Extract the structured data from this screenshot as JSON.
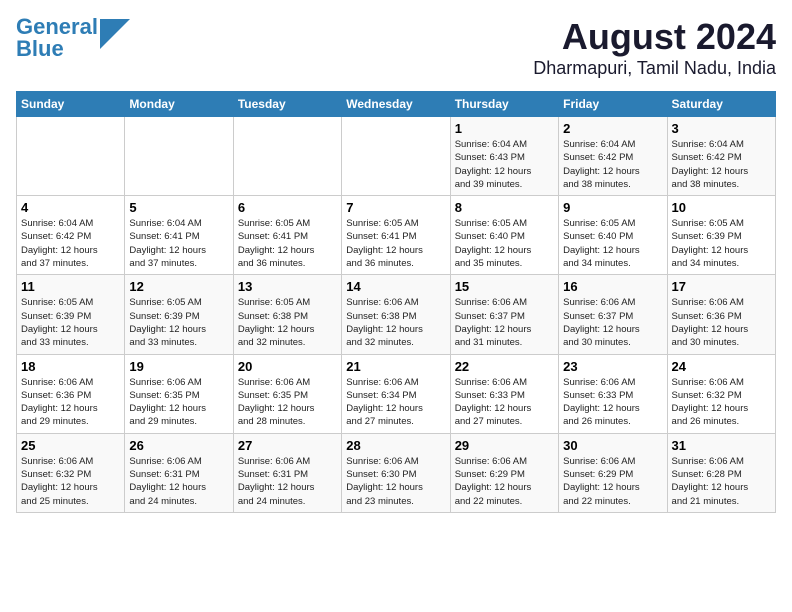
{
  "logo": {
    "line1": "General",
    "line2": "Blue"
  },
  "title": "August 2024",
  "subtitle": "Dharmapuri, Tamil Nadu, India",
  "days_of_week": [
    "Sunday",
    "Monday",
    "Tuesday",
    "Wednesday",
    "Thursday",
    "Friday",
    "Saturday"
  ],
  "weeks": [
    [
      {
        "day": "",
        "info": ""
      },
      {
        "day": "",
        "info": ""
      },
      {
        "day": "",
        "info": ""
      },
      {
        "day": "",
        "info": ""
      },
      {
        "day": "1",
        "info": "Sunrise: 6:04 AM\nSunset: 6:43 PM\nDaylight: 12 hours\nand 39 minutes."
      },
      {
        "day": "2",
        "info": "Sunrise: 6:04 AM\nSunset: 6:42 PM\nDaylight: 12 hours\nand 38 minutes."
      },
      {
        "day": "3",
        "info": "Sunrise: 6:04 AM\nSunset: 6:42 PM\nDaylight: 12 hours\nand 38 minutes."
      }
    ],
    [
      {
        "day": "4",
        "info": "Sunrise: 6:04 AM\nSunset: 6:42 PM\nDaylight: 12 hours\nand 37 minutes."
      },
      {
        "day": "5",
        "info": "Sunrise: 6:04 AM\nSunset: 6:41 PM\nDaylight: 12 hours\nand 37 minutes."
      },
      {
        "day": "6",
        "info": "Sunrise: 6:05 AM\nSunset: 6:41 PM\nDaylight: 12 hours\nand 36 minutes."
      },
      {
        "day": "7",
        "info": "Sunrise: 6:05 AM\nSunset: 6:41 PM\nDaylight: 12 hours\nand 36 minutes."
      },
      {
        "day": "8",
        "info": "Sunrise: 6:05 AM\nSunset: 6:40 PM\nDaylight: 12 hours\nand 35 minutes."
      },
      {
        "day": "9",
        "info": "Sunrise: 6:05 AM\nSunset: 6:40 PM\nDaylight: 12 hours\nand 34 minutes."
      },
      {
        "day": "10",
        "info": "Sunrise: 6:05 AM\nSunset: 6:39 PM\nDaylight: 12 hours\nand 34 minutes."
      }
    ],
    [
      {
        "day": "11",
        "info": "Sunrise: 6:05 AM\nSunset: 6:39 PM\nDaylight: 12 hours\nand 33 minutes."
      },
      {
        "day": "12",
        "info": "Sunrise: 6:05 AM\nSunset: 6:39 PM\nDaylight: 12 hours\nand 33 minutes."
      },
      {
        "day": "13",
        "info": "Sunrise: 6:05 AM\nSunset: 6:38 PM\nDaylight: 12 hours\nand 32 minutes."
      },
      {
        "day": "14",
        "info": "Sunrise: 6:06 AM\nSunset: 6:38 PM\nDaylight: 12 hours\nand 32 minutes."
      },
      {
        "day": "15",
        "info": "Sunrise: 6:06 AM\nSunset: 6:37 PM\nDaylight: 12 hours\nand 31 minutes."
      },
      {
        "day": "16",
        "info": "Sunrise: 6:06 AM\nSunset: 6:37 PM\nDaylight: 12 hours\nand 30 minutes."
      },
      {
        "day": "17",
        "info": "Sunrise: 6:06 AM\nSunset: 6:36 PM\nDaylight: 12 hours\nand 30 minutes."
      }
    ],
    [
      {
        "day": "18",
        "info": "Sunrise: 6:06 AM\nSunset: 6:36 PM\nDaylight: 12 hours\nand 29 minutes."
      },
      {
        "day": "19",
        "info": "Sunrise: 6:06 AM\nSunset: 6:35 PM\nDaylight: 12 hours\nand 29 minutes."
      },
      {
        "day": "20",
        "info": "Sunrise: 6:06 AM\nSunset: 6:35 PM\nDaylight: 12 hours\nand 28 minutes."
      },
      {
        "day": "21",
        "info": "Sunrise: 6:06 AM\nSunset: 6:34 PM\nDaylight: 12 hours\nand 27 minutes."
      },
      {
        "day": "22",
        "info": "Sunrise: 6:06 AM\nSunset: 6:33 PM\nDaylight: 12 hours\nand 27 minutes."
      },
      {
        "day": "23",
        "info": "Sunrise: 6:06 AM\nSunset: 6:33 PM\nDaylight: 12 hours\nand 26 minutes."
      },
      {
        "day": "24",
        "info": "Sunrise: 6:06 AM\nSunset: 6:32 PM\nDaylight: 12 hours\nand 26 minutes."
      }
    ],
    [
      {
        "day": "25",
        "info": "Sunrise: 6:06 AM\nSunset: 6:32 PM\nDaylight: 12 hours\nand 25 minutes."
      },
      {
        "day": "26",
        "info": "Sunrise: 6:06 AM\nSunset: 6:31 PM\nDaylight: 12 hours\nand 24 minutes."
      },
      {
        "day": "27",
        "info": "Sunrise: 6:06 AM\nSunset: 6:31 PM\nDaylight: 12 hours\nand 24 minutes."
      },
      {
        "day": "28",
        "info": "Sunrise: 6:06 AM\nSunset: 6:30 PM\nDaylight: 12 hours\nand 23 minutes."
      },
      {
        "day": "29",
        "info": "Sunrise: 6:06 AM\nSunset: 6:29 PM\nDaylight: 12 hours\nand 22 minutes."
      },
      {
        "day": "30",
        "info": "Sunrise: 6:06 AM\nSunset: 6:29 PM\nDaylight: 12 hours\nand 22 minutes."
      },
      {
        "day": "31",
        "info": "Sunrise: 6:06 AM\nSunset: 6:28 PM\nDaylight: 12 hours\nand 21 minutes."
      }
    ]
  ]
}
